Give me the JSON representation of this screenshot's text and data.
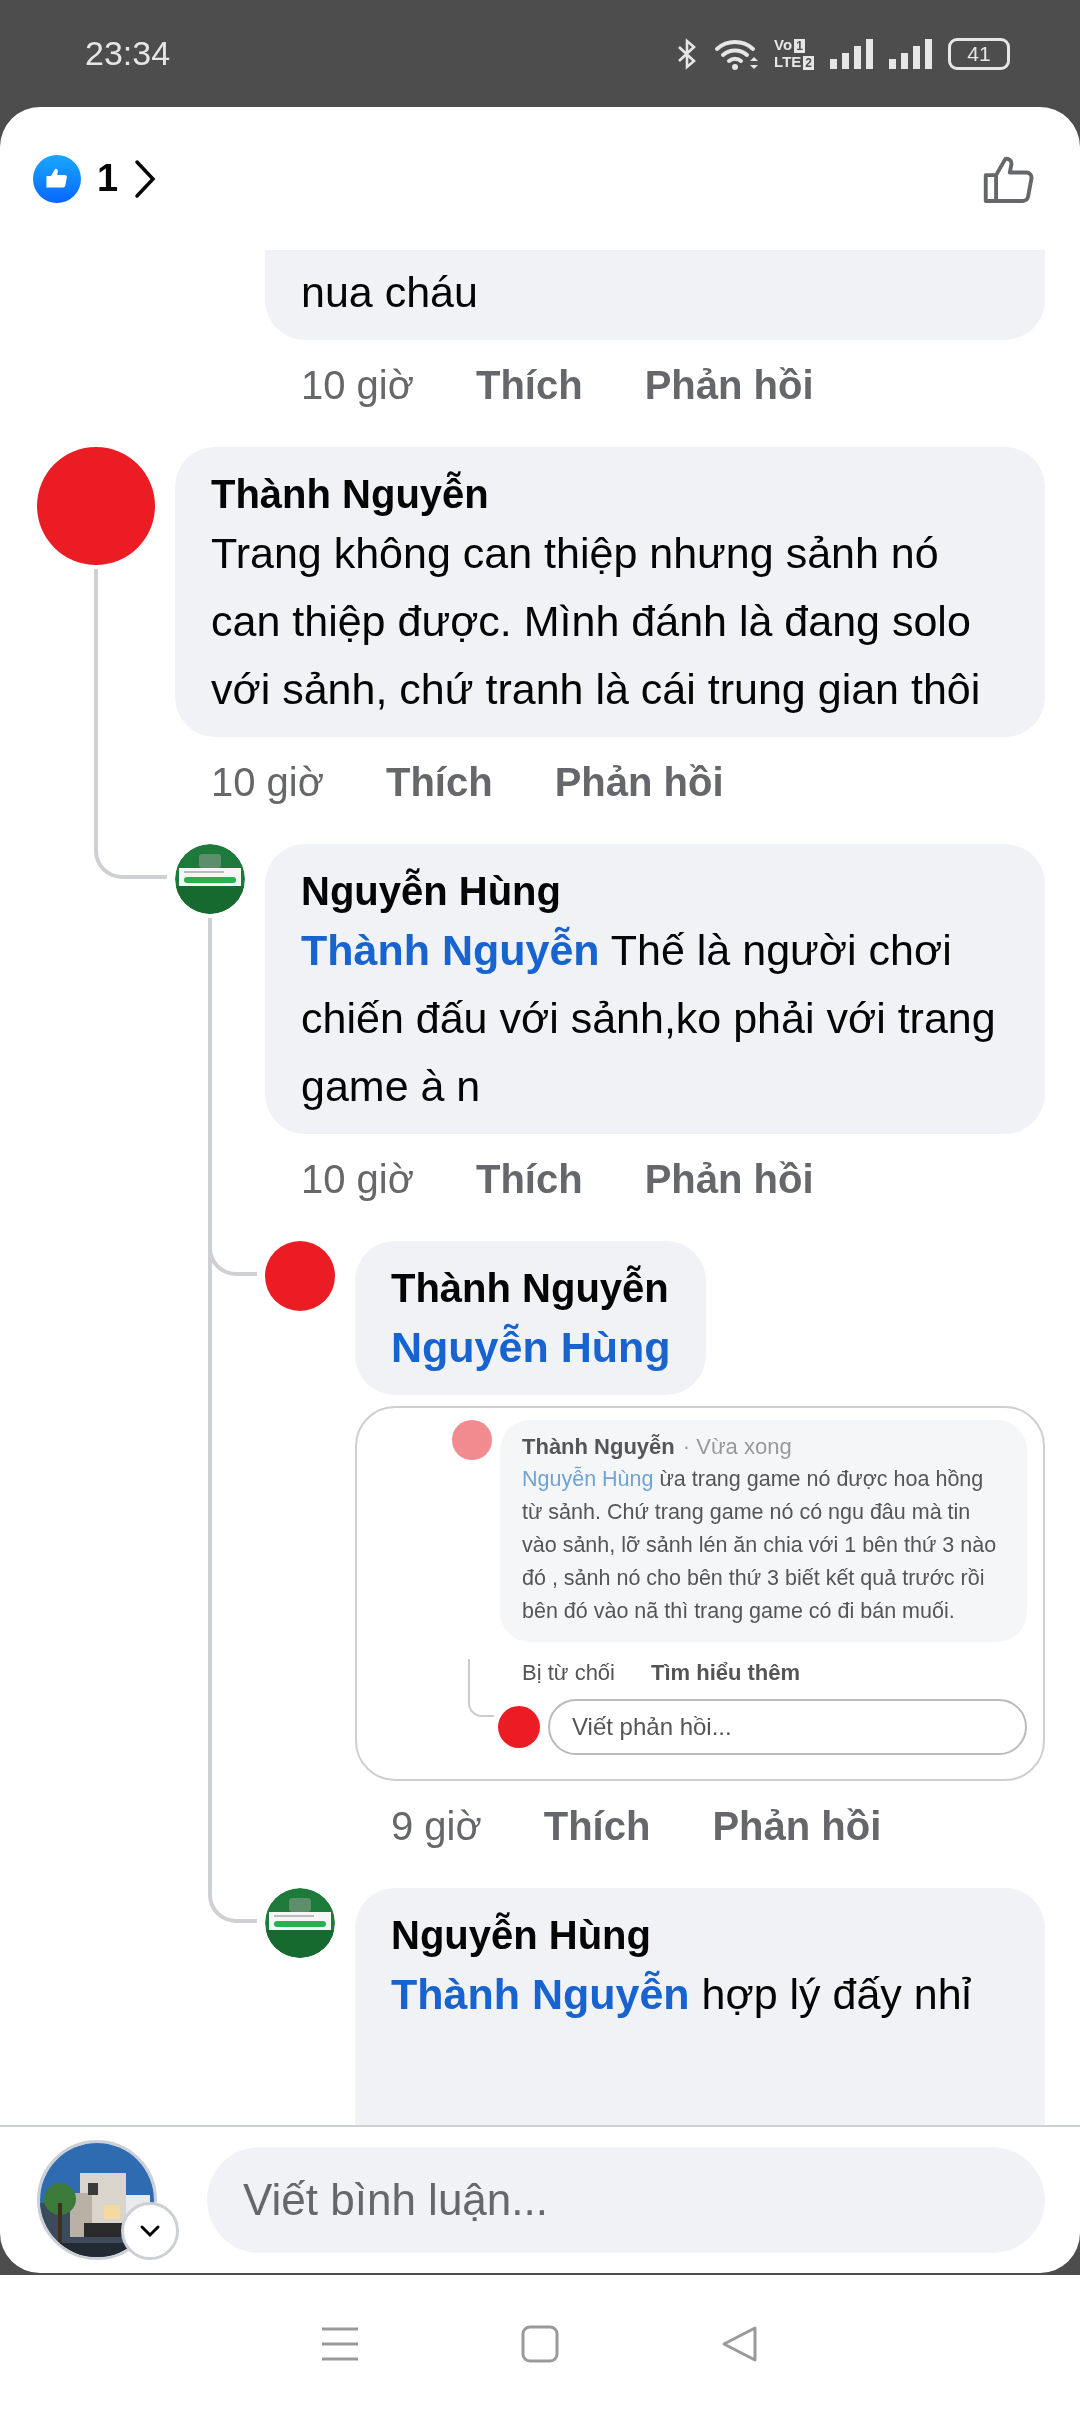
{
  "status_bar": {
    "time": "23:34",
    "volte": {
      "top": "Vo",
      "top_badge": "1",
      "bottom": "LTE",
      "bottom_badge": "2"
    },
    "battery": "41"
  },
  "header": {
    "reactions_count": "1"
  },
  "comments": [
    {
      "continued": true,
      "text": "nua cháu",
      "time": "10 giờ",
      "like": "Thích",
      "reply": "Phản hồi"
    },
    {
      "avatar": {
        "kind": "dot",
        "color": "#ec1c24"
      },
      "author": "Thành Nguyễn",
      "text": "Trang không can thiệp nhưng sảnh nó can thiệp được. Mình đánh là đang solo với sảnh, chứ tranh là cái trung gian thôi",
      "time": "10 giờ",
      "like": "Thích",
      "reply": "Phản hồi",
      "children": [
        {
          "author": "Nguyễn Hùng",
          "mention": "Thành Nguyễn",
          "text": "Thế là người chơi chiến đấu với sảnh,ko phải với trang game à n",
          "time": "10 giờ",
          "like": "Thích",
          "reply": "Phản hồi",
          "children": [
            {
              "avatar": {
                "kind": "dot",
                "color": "#ec1c24"
              },
              "author": "Thành Nguyễn",
              "mention": "Nguyễn Hùng",
              "attachment": {
                "kind": "screenshot",
                "avatar": {
                  "color": "#f28b90"
                },
                "author": "Thành Nguyễn",
                "time": "· Vừa xong",
                "mention": "Nguyễn Hùng",
                "text": "ừa trang game nó được hoa hồng từ sảnh. Chứ trang game nó có ngu đâu mà tin vào sảnh, lỡ sảnh lén ăn chia với 1 bên thứ 3 nào đó , sảnh nó cho bên thứ 3 biết kết quả trước rồi bên đó vào nã thì trang game có đi bán muối.",
                "status": "Bị từ chối",
                "learn_more": "Tìm hiểu thêm",
                "reply_avatar": {
                  "color": "#ec1c24"
                },
                "reply_placeholder": "Viết phản hồi..."
              },
              "time": "9 giờ",
              "like": "Thích",
              "reply": "Phản hồi"
            },
            {
              "author": "Nguyễn Hùng",
              "mention": "Thành Nguyễn",
              "text": "hợp lý đấy nhỉ"
            }
          ]
        }
      ]
    }
  ],
  "composer": {
    "placeholder": "Viết bình luận..."
  }
}
